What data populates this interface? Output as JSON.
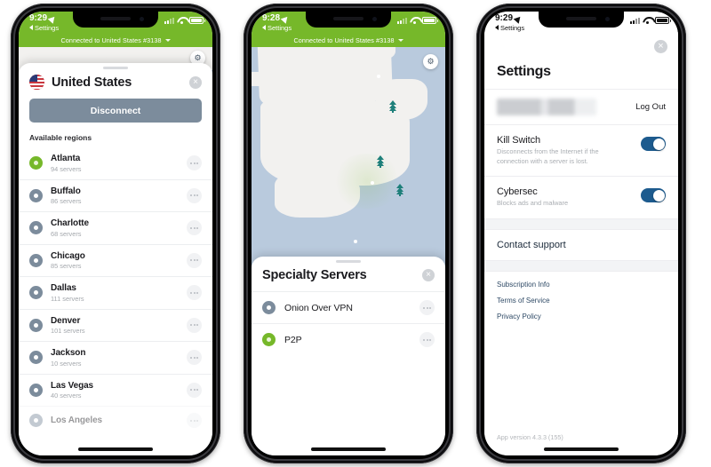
{
  "phones": [
    {
      "id": "phone-country-list",
      "status_bar": {
        "time": "9:29",
        "back_label": "Settings",
        "location_icon": "location-arrow-icon",
        "signal_icon": "cellular-signal-icon",
        "wifi_icon": "wifi-icon",
        "battery_icon": "battery-icon"
      },
      "connection_banner": {
        "text": "Connected to United States #3138",
        "chevron_icon": "chevron-down-icon"
      },
      "sheet": {
        "flag_icon": "us-flag-icon",
        "title": "United States",
        "close_icon": "close-icon",
        "disconnect_label": "Disconnect",
        "section_label": "Available regions",
        "regions": [
          {
            "name": "Atlanta",
            "servers": "94 servers",
            "active": true
          },
          {
            "name": "Buffalo",
            "servers": "86 servers",
            "active": false
          },
          {
            "name": "Charlotte",
            "servers": "68 servers",
            "active": false
          },
          {
            "name": "Chicago",
            "servers": "85 servers",
            "active": false
          },
          {
            "name": "Dallas",
            "servers": "111 servers",
            "active": false
          },
          {
            "name": "Denver",
            "servers": "101 servers",
            "active": false
          },
          {
            "name": "Jackson",
            "servers": "10 servers",
            "active": false
          },
          {
            "name": "Las Vegas",
            "servers": "40 servers",
            "active": false
          },
          {
            "name": "Los Angeles",
            "servers": "",
            "active": false
          }
        ]
      }
    },
    {
      "id": "phone-map-specialty",
      "status_bar": {
        "time": "9:28",
        "back_label": "Settings"
      },
      "connection_banner": {
        "text": "Connected to United States #3138",
        "chevron_icon": "chevron-down-icon"
      },
      "map": {
        "gear_icon": "map-settings-gear-icon"
      },
      "sheet": {
        "title": "Specialty Servers",
        "close_icon": "close-icon",
        "servers": [
          {
            "name": "Onion Over VPN",
            "active": false
          },
          {
            "name": "P2P",
            "active": true
          }
        ]
      }
    },
    {
      "id": "phone-settings",
      "status_bar": {
        "time": "9:29",
        "back_label": "Settings"
      },
      "settings": {
        "close_icon": "close-icon",
        "title": "Settings",
        "account_email_masked": "",
        "logout_label": "Log Out",
        "toggles": [
          {
            "name": "Kill Switch",
            "desc": "Disconnects from the Internet if the connection with a server is lost.",
            "on": true
          },
          {
            "name": "Cybersec",
            "desc": "Blocks ads and malware",
            "on": true
          }
        ],
        "contact_label": "Contact support",
        "links": [
          "Subscription Info",
          "Terms of Service",
          "Privacy Policy"
        ],
        "app_version": "App version 4.3.3 (155)"
      }
    }
  ],
  "colors": {
    "brand_green": "#76b82a",
    "disconnect_gray": "#7c8c9c",
    "toggle_blue": "#1d5b8e",
    "map_water": "#b9cadd",
    "map_land": "#f2f1ef",
    "pin_blue": "#1d4f7c",
    "tree_teal": "#1e7f7a"
  }
}
